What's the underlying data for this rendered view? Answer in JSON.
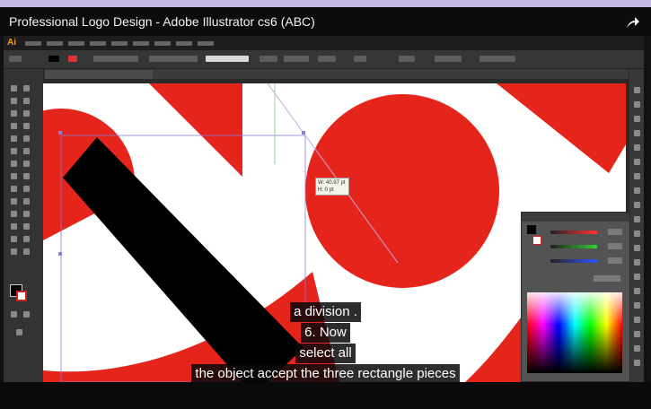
{
  "video": {
    "title": "Professional Logo Design - Adobe Illustrator cs6 (ABC)",
    "share_icon": "share-arrow-icon"
  },
  "app": {
    "logo": "Ai",
    "accent": "#f29a1e"
  },
  "artwork": {
    "red": "#e5241b",
    "white": "#ffffff",
    "black": "#000000"
  },
  "tooltip": {
    "line1": "W: 40.97 pt",
    "line2": "H: 0 pt"
  },
  "captions": [
    "a division .",
    "6. Now",
    "select all",
    "the object accept the three rectangle pieces"
  ]
}
